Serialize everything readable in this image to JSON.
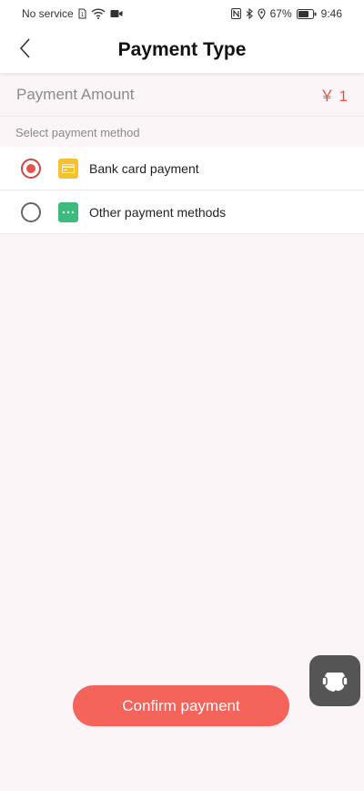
{
  "status_bar": {
    "carrier": "No service",
    "battery": "67%",
    "time": "9:46"
  },
  "header": {
    "title": "Payment Type",
    "back_icon": "chevron-left-icon"
  },
  "payment": {
    "amount_label": "Payment Amount",
    "amount_value": "￥ 1",
    "section_label": "Select payment method"
  },
  "methods": [
    {
      "label": "Bank card payment",
      "icon": "bank-card-icon",
      "selected": true,
      "icon_color": "#f6c12f"
    },
    {
      "label": "Other payment methods",
      "icon": "more-icon",
      "selected": false,
      "icon_color": "#3dbb7e"
    }
  ],
  "actions": {
    "confirm_label": "Confirm payment",
    "support_icon": "customer-service-icon"
  },
  "colors": {
    "accent": "#f5645a",
    "amount": "#e05a42",
    "background": "#fcf5f8"
  }
}
